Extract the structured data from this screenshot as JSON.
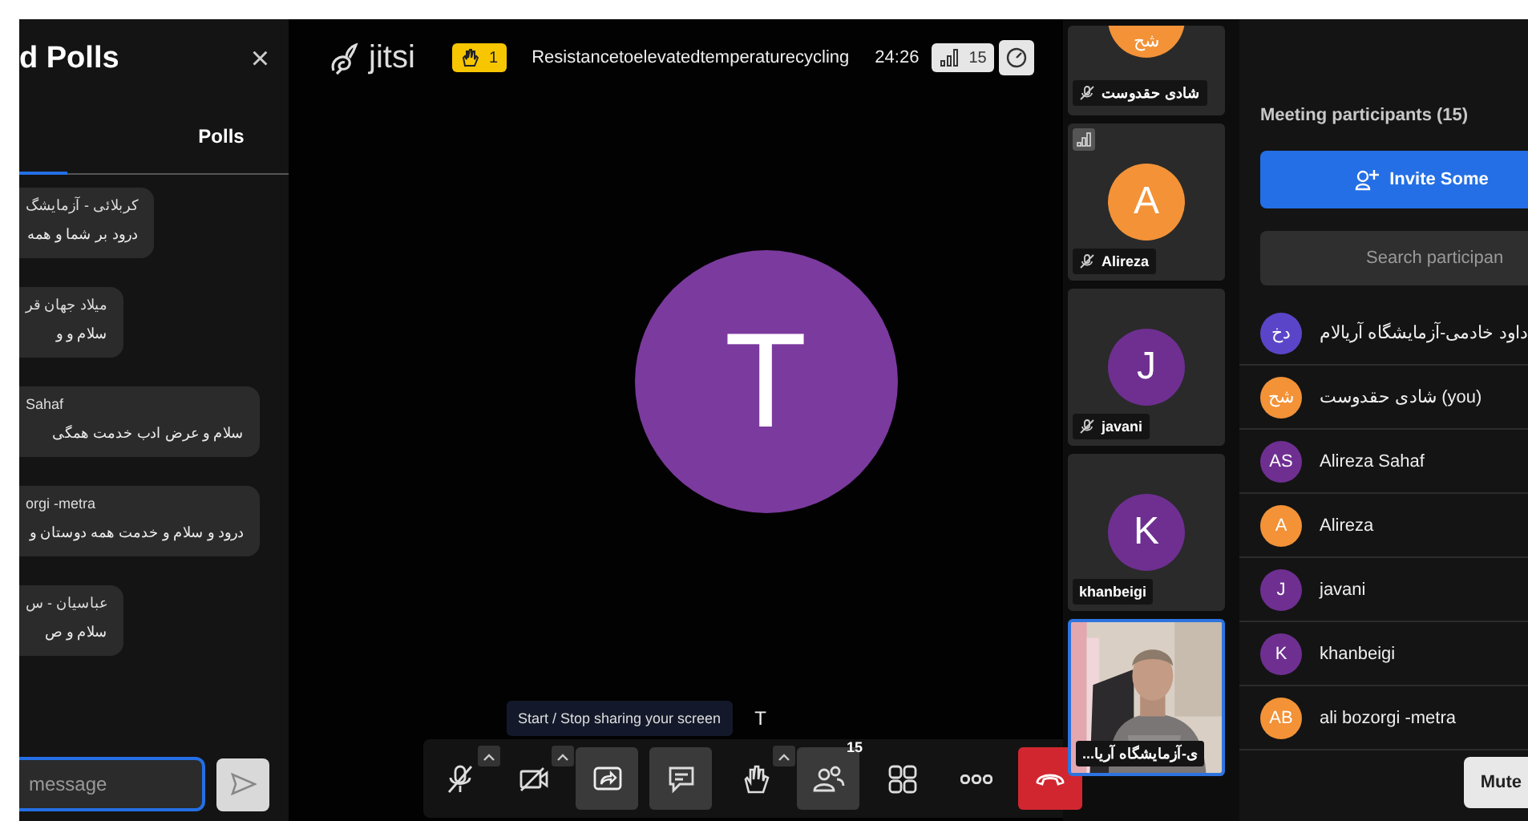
{
  "chat_panel": {
    "title": "d Polls",
    "close": "×",
    "tabs": [
      {
        "label": "Polls",
        "selected": false
      }
    ],
    "messages": [
      {
        "sender": "کربلائی - آزمایشگ",
        "text": "درود بر شما و همه"
      },
      {
        "sender": "میلاد جهان قر",
        "text": "سلام و و"
      },
      {
        "sender": "Sahaf",
        "text": "سلام و عرض ادب خدمت همگی"
      },
      {
        "sender": "orgi -metra",
        "text": "درود و سلام و خدمت همه دوستان و"
      },
      {
        "sender": "عباسیان - س",
        "text": "سلام و ص"
      }
    ],
    "input": {
      "placeholder": "message"
    }
  },
  "top_bar": {
    "logo_text": "jitsi",
    "raised_hands": "1",
    "meeting_title": "Resistancetoelevatedtemperaturecycling",
    "timer": "24:26",
    "participant_count": "15"
  },
  "stage": {
    "initial": "T",
    "color": "#7b3a9e",
    "speaker_label": "T",
    "tooltip": "Start / Stop sharing your screen"
  },
  "toolbar": [
    {
      "kind": "mic",
      "caret": true,
      "active": false
    },
    {
      "kind": "camera",
      "caret": true,
      "active": false
    },
    {
      "kind": "share",
      "caret": false,
      "active": true
    },
    {
      "kind": "chat",
      "caret": false,
      "active": true
    },
    {
      "kind": "hand",
      "caret": true,
      "active": false
    },
    {
      "kind": "participants",
      "caret": false,
      "active": true,
      "badge": "15"
    },
    {
      "kind": "tiles",
      "caret": false,
      "active": false
    },
    {
      "kind": "more",
      "caret": false,
      "active": false
    },
    {
      "kind": "hangup",
      "caret": false,
      "active": false
    }
  ],
  "tiles": [
    {
      "kind": "avatar",
      "initials": "شح",
      "name": "شادی حقدوست",
      "color": "#f39237",
      "muted": true,
      "connection_indicator": false,
      "selected": false
    },
    {
      "kind": "avatar",
      "initials": "A",
      "name": "Alireza",
      "color": "#f39237",
      "muted": true,
      "connection_indicator": true,
      "selected": false
    },
    {
      "kind": "avatar",
      "initials": "J",
      "name": "javani",
      "color": "#6e2f91",
      "muted": true,
      "connection_indicator": false,
      "selected": false
    },
    {
      "kind": "avatar",
      "initials": "K",
      "name": "khanbeigi",
      "color": "#6e2f91",
      "muted": false,
      "connection_indicator": false,
      "selected": false
    },
    {
      "kind": "video",
      "name": "...ی-آزمایشگاه آریا",
      "muted": false,
      "connection_indicator": false,
      "selected": true
    }
  ],
  "participants_panel": {
    "heading": "Meeting participants (15)",
    "invite_button": "Invite Some",
    "search": {
      "placeholder": "Search participan"
    },
    "participants": [
      {
        "initials": "دخ",
        "name": "داود خادمی-آزمایشگاه آریالام",
        "color": "#5a45c9"
      },
      {
        "initials": "شح",
        "name": "شادی حقدوست (you)",
        "color": "#f39237"
      },
      {
        "initials": "AS",
        "name": "Alireza Sahaf",
        "color": "#6e2f91"
      },
      {
        "initials": "A",
        "name": "Alireza",
        "color": "#f39237"
      },
      {
        "initials": "J",
        "name": "javani",
        "color": "#6e2f91"
      },
      {
        "initials": "K",
        "name": "khanbeigi",
        "color": "#6e2f91"
      },
      {
        "initials": "AB",
        "name": "ali bozorgi -metra",
        "color": "#f39237"
      }
    ],
    "mute_button": "Mute"
  }
}
